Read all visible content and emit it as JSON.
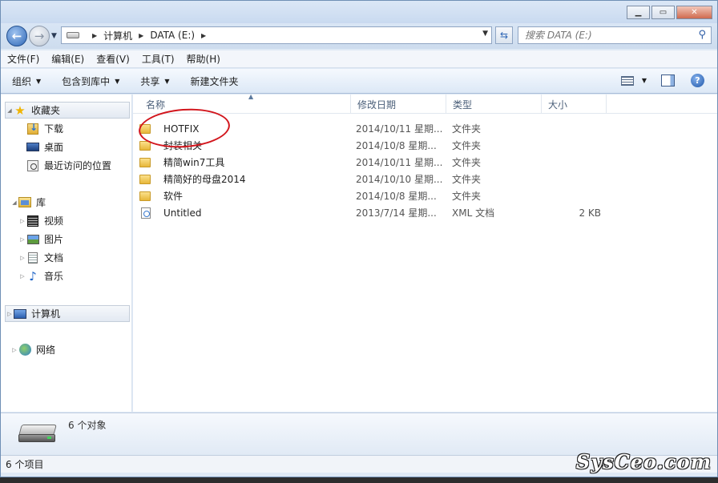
{
  "window": {
    "caption_buttons": [
      "minimize",
      "maximize",
      "close"
    ]
  },
  "address": {
    "segments": [
      "计算机",
      "DATA (E:)"
    ]
  },
  "search": {
    "placeholder": "搜索 DATA (E:)"
  },
  "menu": [
    "文件(F)",
    "编辑(E)",
    "查看(V)",
    "工具(T)",
    "帮助(H)"
  ],
  "commands": {
    "organize": "组织",
    "include_in_library": "包含到库中",
    "share": "共享",
    "new_folder": "新建文件夹"
  },
  "nav": {
    "favorites": "收藏夹",
    "downloads": "下载",
    "desktop": "桌面",
    "recent": "最近访问的位置",
    "libraries": "库",
    "videos": "视频",
    "pictures": "图片",
    "documents": "文档",
    "music": "音乐",
    "computer": "计算机",
    "network": "网络"
  },
  "columns": {
    "name": "名称",
    "date": "修改日期",
    "type": "类型",
    "size": "大小"
  },
  "files": [
    {
      "name": "HOTFIX",
      "date": "2014/10/11 星期...",
      "type": "文件夹",
      "size": "",
      "icon": "folder-icon"
    },
    {
      "name": "封装相关",
      "date": "2014/10/8 星期...",
      "type": "文件夹",
      "size": "",
      "icon": "folder-icon"
    },
    {
      "name": "精简win7工具",
      "date": "2014/10/11 星期...",
      "type": "文件夹",
      "size": "",
      "icon": "folder-icon"
    },
    {
      "name": "精简好的母盘2014",
      "date": "2014/10/10 星期...",
      "type": "文件夹",
      "size": "",
      "icon": "folder-icon"
    },
    {
      "name": "软件",
      "date": "2014/10/8 星期...",
      "type": "文件夹",
      "size": "",
      "icon": "folder-icon"
    },
    {
      "name": "Untitled",
      "date": "2013/7/14 星期...",
      "type": "XML 文档",
      "size": "2 KB",
      "icon": "xml-file-icon"
    }
  ],
  "details": {
    "count": "6 个对象"
  },
  "status": {
    "items": "6 个项目"
  },
  "watermark": "SysCeo.com",
  "colors": {
    "annotation": "#d2161d",
    "selection": "#e3e9f2",
    "accent": "#2f67b6"
  }
}
